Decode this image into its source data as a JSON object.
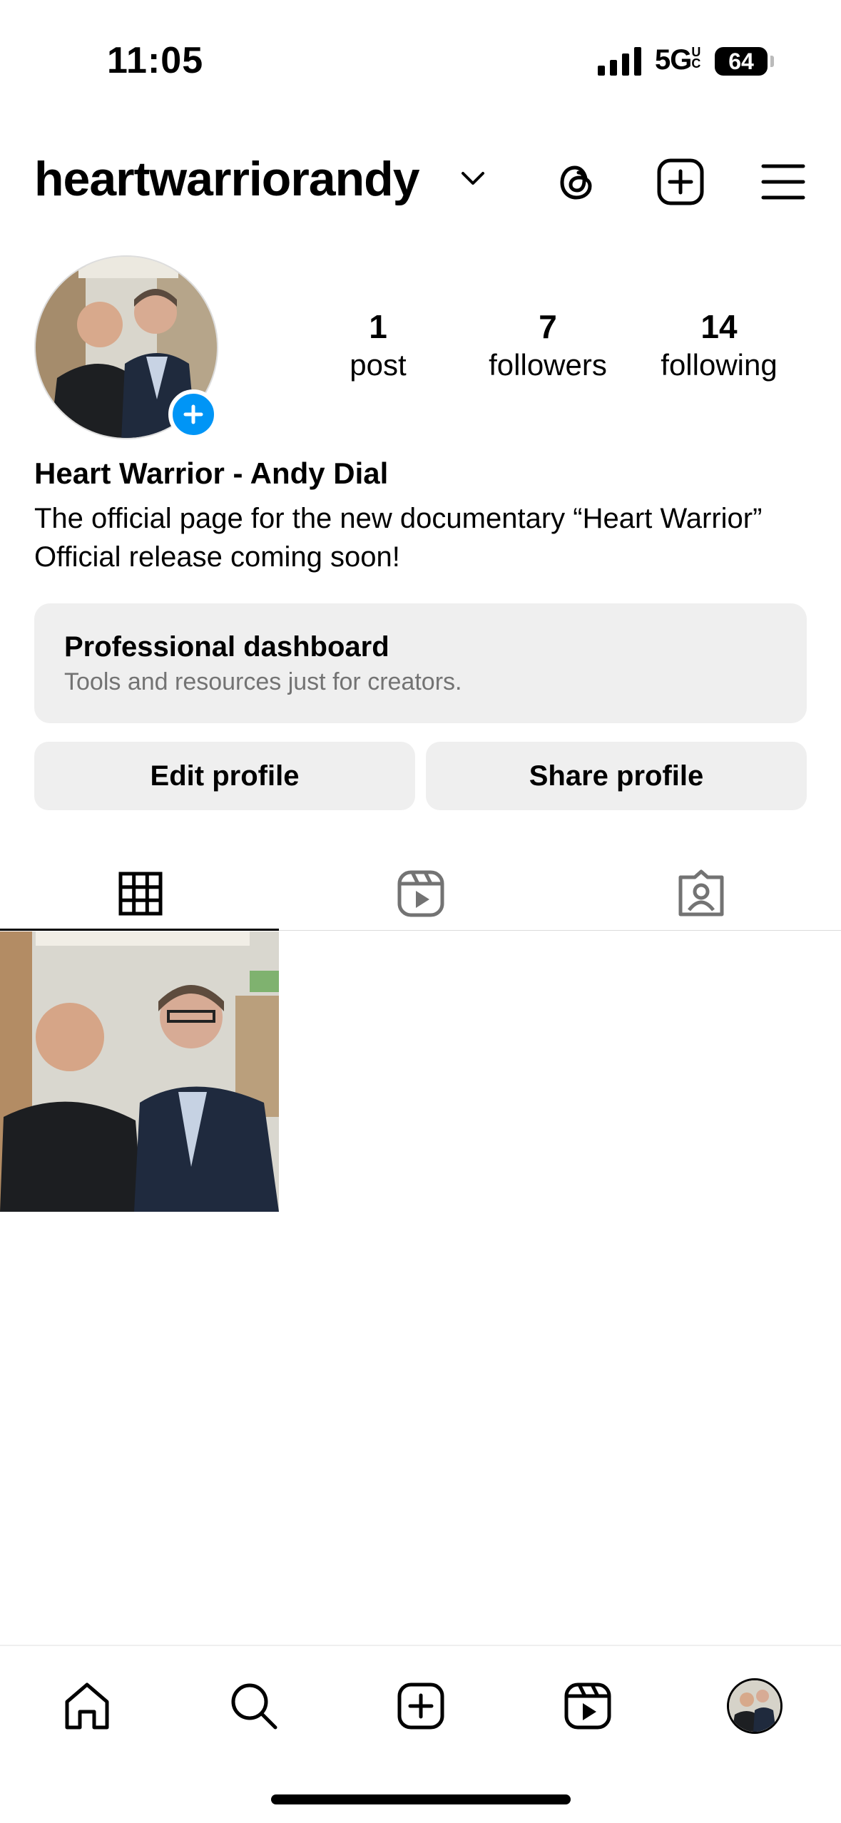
{
  "status_bar": {
    "time": "11:05",
    "network": "5G",
    "network_sup": "UC",
    "battery": "64"
  },
  "header": {
    "username": "heartwarriorandy"
  },
  "profile": {
    "stats": [
      {
        "value": "1",
        "label": "post"
      },
      {
        "value": "7",
        "label": "followers"
      },
      {
        "value": "14",
        "label": "following"
      }
    ],
    "full_name": "Heart Warrior - Andy Dial",
    "bio": "The official page for the new documentary “Heart Warrior” Official release coming soon!"
  },
  "dashboard": {
    "title": "Professional dashboard",
    "subtitle": "Tools and resources just for creators."
  },
  "actions": {
    "edit": "Edit profile",
    "share": "Share profile"
  },
  "tabs": [
    {
      "icon": "grid-icon",
      "active": true
    },
    {
      "icon": "reels-icon",
      "active": false
    },
    {
      "icon": "tagged-icon",
      "active": false
    }
  ],
  "bottom_nav": [
    "home-icon",
    "search-icon",
    "create-icon",
    "reels-icon",
    "profile-avatar"
  ],
  "colors": {
    "accent": "#0095f6",
    "button_bg": "#efefef",
    "secondary_text": "#737373"
  }
}
